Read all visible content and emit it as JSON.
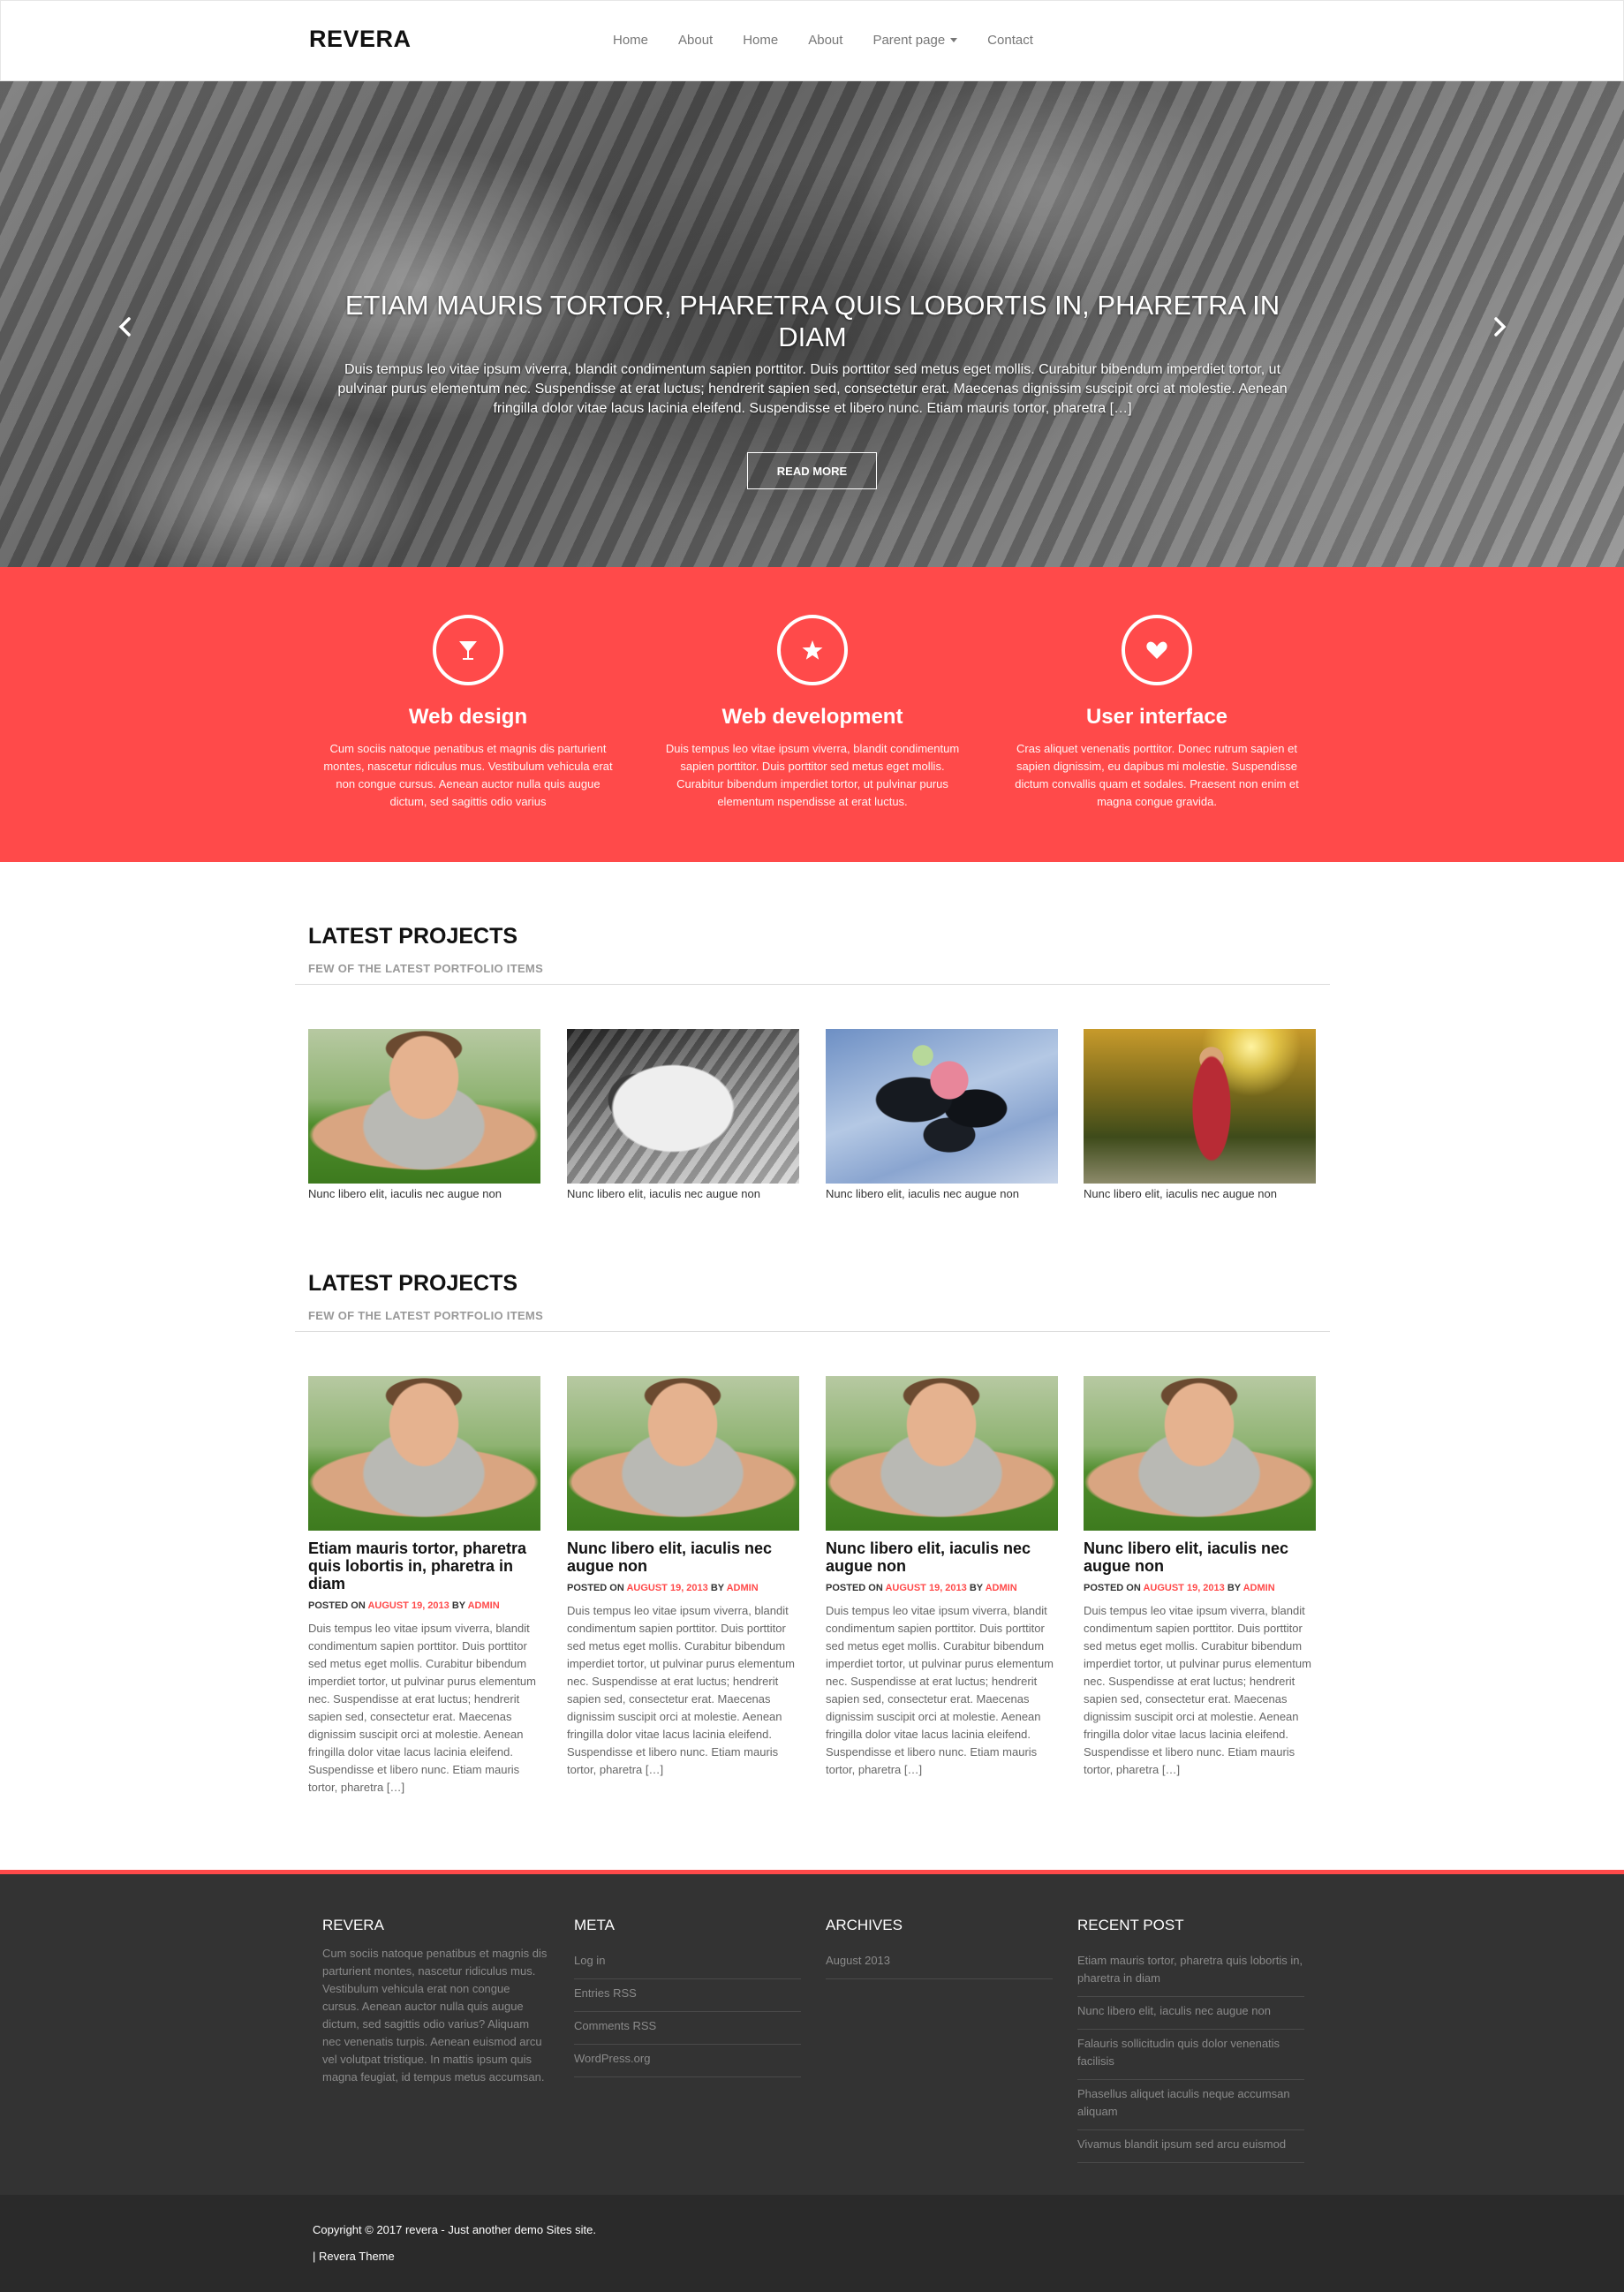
{
  "header": {
    "brand": "REVERA",
    "nav": [
      "Home",
      "About",
      "Home",
      "About",
      "Parent page",
      "Contact"
    ]
  },
  "hero": {
    "title": "ETIAM MAURIS TORTOR, PHARETRA QUIS LOBORTIS IN, PHARETRA IN DIAM",
    "text": "Duis tempus leo vitae ipsum viverra, blandit condimentum sapien porttitor. Duis porttitor sed metus eget mollis. Curabitur bibendum imperdiet tortor, ut pulvinar purus elementum nec. Suspendisse at erat luctus; hendrerit sapien sed, consectetur erat. Maecenas dignissim suscipit orci at molestie. Aenean fringilla dolor vitae lacus lacinia eleifend. Suspendisse et libero nunc. Etiam mauris tortor, pharetra […]",
    "button": "READ MORE",
    "image_icon": "sleeping-cat-photo"
  },
  "services": [
    {
      "icon": "cocktail-glass-icon",
      "title": "Web design",
      "text": "Cum sociis natoque penatibus et magnis dis parturient montes, nascetur ridiculus mus. Vestibulum vehicula erat non congue cursus. Aenean auctor nulla quis augue dictum, sed sagittis odio varius"
    },
    {
      "icon": "star-icon",
      "title": "Web development",
      "text": "Duis tempus leo vitae ipsum viverra, blandit condimentum sapien porttitor. Duis porttitor sed metus eget mollis. Curabitur bibendum imperdiet tortor, ut pulvinar purus elementum nspendisse at erat luctus."
    },
    {
      "icon": "heart-icon",
      "title": "User interface",
      "text": "Cras aliquet venenatis porttitor. Donec rutrum sapien et sapien dignissim, eu dapibus mi molestie. Suspendisse dictum convallis quam et sodales. Praesent non enim et magna congue gravida."
    }
  ],
  "projects": {
    "title": "LATEST PROJECTS",
    "subtitle": "FEW OF THE LATEST PORTFOLIO ITEMS",
    "items": [
      {
        "caption": "Nunc libero elit, iaculis nec augue non",
        "image": "pushup-man-photo"
      },
      {
        "caption": "Nunc libero elit, iaculis nec augue non",
        "image": "kitten-photo"
      },
      {
        "caption": "Nunc libero elit, iaculis nec augue non",
        "image": "rose-stones-photo"
      },
      {
        "caption": "Nunc libero elit, iaculis nec augue non",
        "image": "girl-sunset-photo"
      }
    ]
  },
  "blog": {
    "title": "LATEST PROJECTS",
    "subtitle": "FEW OF THE LATEST PORTFOLIO ITEMS",
    "posts": [
      {
        "title": "Etiam mauris tortor, pharetra quis lobortis in, pharetra in diam",
        "posted_on": "POSTED ON",
        "date": "AUGUST 19, 2013",
        "by": "BY",
        "author": "ADMIN",
        "text": "Duis tempus leo vitae ipsum viverra, blandit condimentum sapien porttitor. Duis porttitor sed metus eget mollis. Curabitur bibendum imperdiet tortor, ut pulvinar purus elementum nec. Suspendisse at erat luctus; hendrerit sapien sed, consectetur erat. Maecenas dignissim suscipit orci at molestie. Aenean fringilla dolor vitae lacus lacinia eleifend. Suspendisse et libero nunc. Etiam mauris tortor, pharetra […]"
      },
      {
        "title": "Nunc libero elit, iaculis nec augue non",
        "posted_on": "POSTED ON",
        "date": "AUGUST 19, 2013",
        "by": "BY",
        "author": "ADMIN",
        "text": "Duis tempus leo vitae ipsum viverra, blandit condimentum sapien porttitor. Duis porttitor sed metus eget mollis. Curabitur bibendum imperdiet tortor, ut pulvinar purus elementum nec. Suspendisse at erat luctus; hendrerit sapien sed, consectetur erat. Maecenas dignissim suscipit orci at molestie. Aenean fringilla dolor vitae lacus lacinia eleifend. Suspendisse et libero nunc. Etiam mauris tortor, pharetra […]"
      },
      {
        "title": "Nunc libero elit, iaculis nec augue non",
        "posted_on": "POSTED ON",
        "date": "AUGUST 19, 2013",
        "by": "BY",
        "author": "ADMIN",
        "text": "Duis tempus leo vitae ipsum viverra, blandit condimentum sapien porttitor. Duis porttitor sed metus eget mollis. Curabitur bibendum imperdiet tortor, ut pulvinar purus elementum nec. Suspendisse at erat luctus; hendrerit sapien sed, consectetur erat. Maecenas dignissim suscipit orci at molestie. Aenean fringilla dolor vitae lacus lacinia eleifend. Suspendisse et libero nunc. Etiam mauris tortor, pharetra […]"
      },
      {
        "title": "Nunc libero elit, iaculis nec augue non",
        "posted_on": "POSTED ON",
        "date": "AUGUST 19, 2013",
        "by": "BY",
        "author": "ADMIN",
        "text": "Duis tempus leo vitae ipsum viverra, blandit condimentum sapien porttitor. Duis porttitor sed metus eget mollis. Curabitur bibendum imperdiet tortor, ut pulvinar purus elementum nec. Suspendisse at erat luctus; hendrerit sapien sed, consectetur erat. Maecenas dignissim suscipit orci at molestie. Aenean fringilla dolor vitae lacus lacinia eleifend. Suspendisse et libero nunc. Etiam mauris tortor, pharetra […]"
      }
    ]
  },
  "footer": {
    "about": {
      "title": "REVERA",
      "text": "Cum sociis natoque penatibus et magnis dis parturient montes, nascetur ridiculus mus. Vestibulum vehicula erat non congue cursus. Aenean auctor nulla quis augue dictum, sed sagittis odio varius? Aliquam nec venenatis turpis. Aenean euismod arcu vel volutpat tristique. In mattis ipsum quis magna feugiat, id tempus metus accumsan."
    },
    "meta": {
      "title": "META",
      "items": [
        "Log in",
        "Entries RSS",
        "Comments RSS",
        "WordPress.org"
      ]
    },
    "archives": {
      "title": "ARCHIVES",
      "items": [
        "August 2013"
      ]
    },
    "recent": {
      "title": "RECENT POST",
      "items": [
        "Etiam mauris tortor, pharetra quis lobortis in, pharetra in diam",
        "Nunc libero elit, iaculis nec augue non",
        "Falauris sollicitudin quis dolor venenatis facilisis",
        "Phasellus aliquet iaculis neque accumsan aliquam",
        "Vivamus blandit ipsum sed arcu euismod"
      ]
    },
    "copyright": "Copyright © 2017 revera - Just another demo Sites site.",
    "theme": "| Revera Theme"
  },
  "colors": {
    "accent": "#ff4a4a",
    "footer_bg": "#333333",
    "bottom_bg": "#2a2a2a"
  }
}
